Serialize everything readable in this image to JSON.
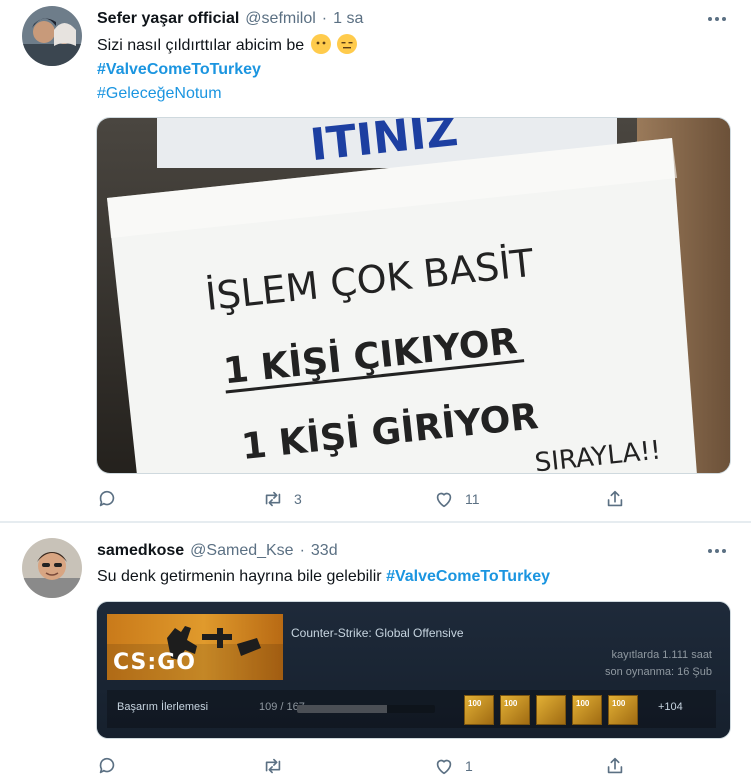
{
  "tweets": [
    {
      "display_name": "Sefer yaşar official",
      "handle": "@sefmilol",
      "dot": "·",
      "time": "1 sa",
      "text": "Sizi nasıl çıldırttılar abicim be",
      "emojis": [
        "no-mouth-face-emoji",
        "expressionless-face-emoji"
      ],
      "hashtags": [
        "#ValveComeToTurkey",
        "#GeleceğeNotum"
      ],
      "media": {
        "sign_top": "ITINIZ",
        "line1": "İŞLEM ÇOK BASİT",
        "line2": "1 KİŞİ ÇIKIYOR",
        "line3": "1 KİŞİ GİRİYOR",
        "line4": "SIRAYLA!!"
      },
      "actions": {
        "reply": "",
        "retweet": "3",
        "like": "11"
      }
    },
    {
      "display_name": "samedkose",
      "handle": "@Samed_Kse",
      "dot": "·",
      "time": "33d",
      "text": "Su denk getirmenin hayrına bile gelebilir",
      "hashtag": "#ValveComeToTurkey",
      "steam_card": {
        "logo": "CS:GO",
        "game": "Counter-Strike: Global Offensive",
        "hours": "kayıtlarda 1.111 saat",
        "last_played": "son oynanma: 16 Şub",
        "achievements_label": "Başarım İlerlemesi",
        "achievements_count": "109 / 167",
        "achievements_progress": 0.65,
        "achievement_badges": [
          "100",
          "100",
          "",
          "100",
          "100"
        ],
        "more": "+104"
      },
      "actions": {
        "reply": "",
        "retweet": "",
        "like": "1"
      }
    }
  ],
  "colors": {
    "hashtag": "#1b95e0",
    "secondary_text": "#5b7083",
    "steam_bg": "#1b2838"
  }
}
